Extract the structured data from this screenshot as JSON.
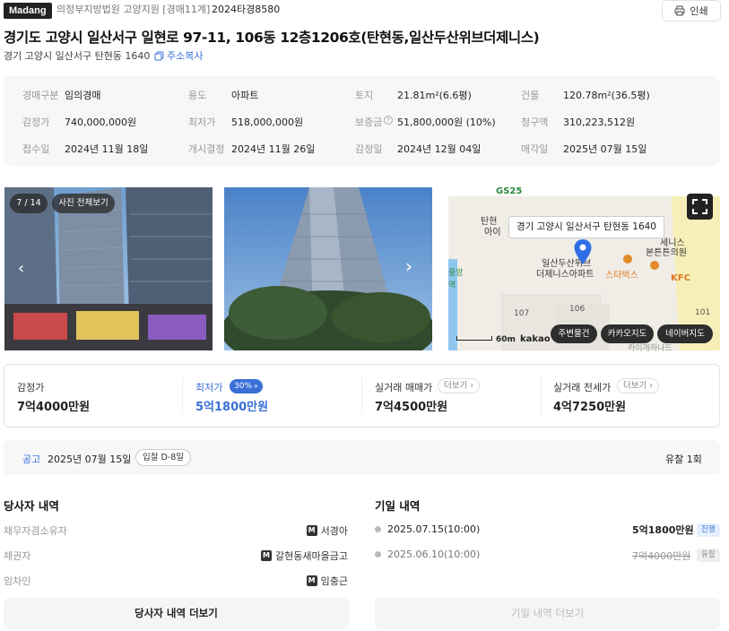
{
  "header": {
    "logo": "Madang",
    "court": "의정부지방법원 고양지원 [경매11계]",
    "case_no": "2024타경8580",
    "print_label": "인쇄"
  },
  "title": "경기도 고양시 일산서구 일현로 97-11, 106동 12층1206호(탄현동,일산두산위브더제니스)",
  "address": "경기 고양시 일산서구 탄현동 1640",
  "copy_label": "주소복사",
  "info": [
    {
      "label": "경매구분",
      "value": "임의경매"
    },
    {
      "label": "용도",
      "value": "아파트"
    },
    {
      "label": "토지",
      "value": "21.81m²(6.6평)"
    },
    {
      "label": "건물",
      "value": "120.78m²(36.5평)"
    },
    {
      "label": "감정가",
      "value": "740,000,000원"
    },
    {
      "label": "최저가",
      "value": "518,000,000원"
    },
    {
      "label": "보증금",
      "value": "51,800,000원 (10%)"
    },
    {
      "label": "청구액",
      "value": "310,223,512원"
    },
    {
      "label": "접수일",
      "value": "2024년 11월 18일"
    },
    {
      "label": "개시결정",
      "value": "2024년 11월 26일"
    },
    {
      "label": "감정일",
      "value": "2024년 12월 04일"
    },
    {
      "label": "매각일",
      "value": "2025년 07월 15일"
    }
  ],
  "gallery": {
    "counter": "7 / 14",
    "all_photos": "사진 전체보기"
  },
  "map": {
    "tooltip": "경기 고양시 일산서구 탄현동 1640",
    "labels": [
      "GS25",
      "탄현",
      "아이",
      "일산두산위브",
      "더제니스아파트",
      "세니스",
      "본튼튼의원",
      "스타벅스",
      "KFC",
      "107",
      "106",
      "101",
      "중앙",
      "역",
      "카이개하나드"
    ],
    "scale": "60m",
    "brand": "kakao",
    "buttons": [
      "주변물건",
      "카카오지도",
      "네이버지도"
    ]
  },
  "prices": {
    "appraisal_label": "감정가",
    "appraisal_value": "7억4000만원",
    "min_label": "최저가",
    "min_badge": "30%",
    "min_value": "5억1800만원",
    "trade_label": "실거래 매매가",
    "trade_value": "7억4500만원",
    "jeonse_label": "실거래 전세가",
    "jeonse_value": "4억7250만원",
    "more_label": "더보기"
  },
  "notice": {
    "label": "공고",
    "date": "2025년 07월 15일",
    "dday": "입찰 D-8일",
    "fail": "유찰 1회"
  },
  "parties": {
    "title": "당사자 내역",
    "rows": [
      {
        "label": "채무자겸소유자",
        "value": "서경아"
      },
      {
        "label": "채권자",
        "value": "갈현동새마을금고"
      },
      {
        "label": "임차인",
        "value": "임충근"
      }
    ],
    "badge": "M",
    "more_button": "당사자 내역 더보기"
  },
  "schedule": {
    "title": "기일 내역",
    "rows": [
      {
        "date": "2025.07.15(10:00)",
        "price": "5억1800만원",
        "status": "진행"
      },
      {
        "date": "2025.06.10(10:00)",
        "price": "7억4000만원",
        "status": "유찰"
      }
    ],
    "more_button": "기일 내역 더보기"
  },
  "colors": {
    "accent": "#3a6fd8",
    "pin": "#2f6fe6"
  }
}
